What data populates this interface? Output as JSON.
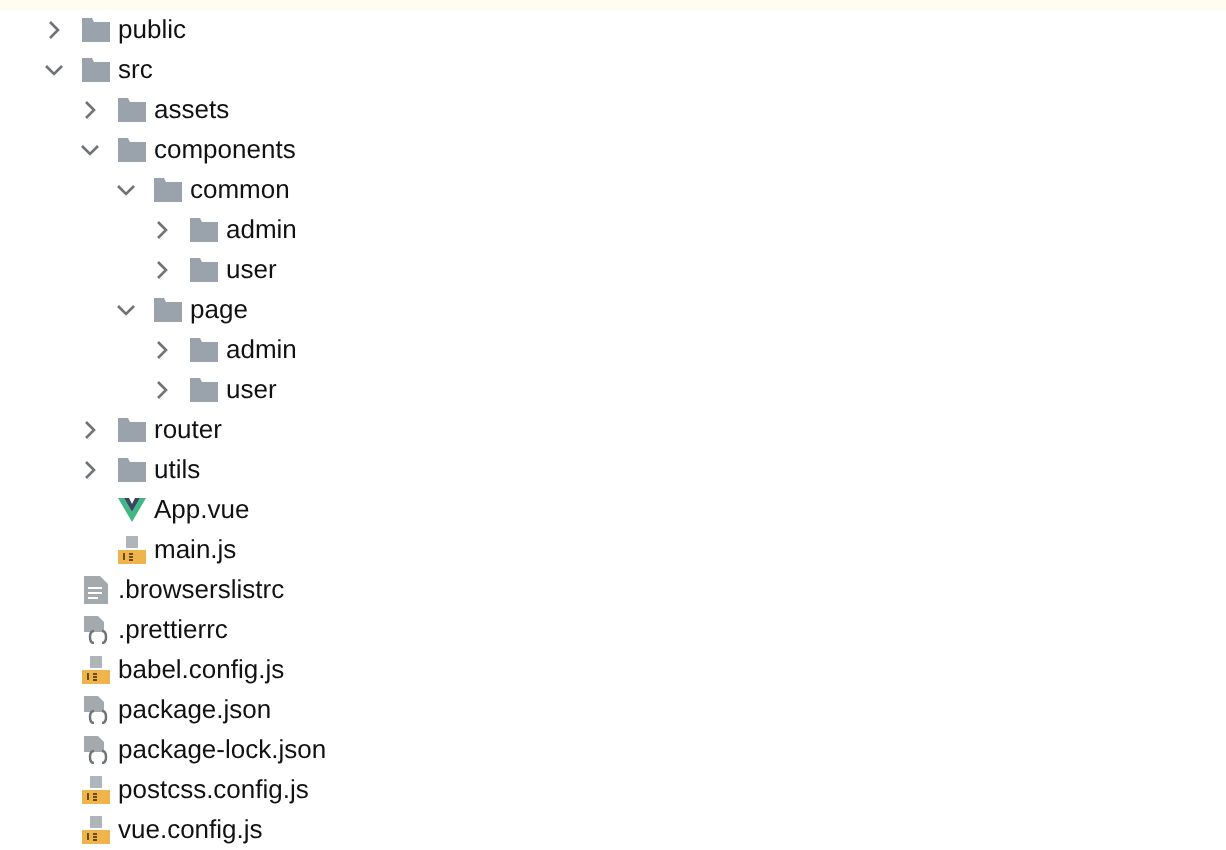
{
  "tree": [
    {
      "name": "public",
      "kind": "folder",
      "expanded": false
    },
    {
      "name": "src",
      "kind": "folder",
      "expanded": true,
      "children": [
        {
          "name": "assets",
          "kind": "folder",
          "expanded": false
        },
        {
          "name": "components",
          "kind": "folder",
          "expanded": true,
          "children": [
            {
              "name": "common",
              "kind": "folder",
              "expanded": true,
              "children": [
                {
                  "name": "admin",
                  "kind": "folder",
                  "expanded": false
                },
                {
                  "name": "user",
                  "kind": "folder",
                  "expanded": false
                }
              ]
            },
            {
              "name": "page",
              "kind": "folder",
              "expanded": true,
              "children": [
                {
                  "name": "admin",
                  "kind": "folder",
                  "expanded": false
                },
                {
                  "name": "user",
                  "kind": "folder",
                  "expanded": false
                }
              ]
            }
          ]
        },
        {
          "name": "router",
          "kind": "folder",
          "expanded": false
        },
        {
          "name": "utils",
          "kind": "folder",
          "expanded": false
        },
        {
          "name": "App.vue",
          "kind": "vue"
        },
        {
          "name": "main.js",
          "kind": "js"
        }
      ]
    },
    {
      "name": ".browserslistrc",
      "kind": "text"
    },
    {
      "name": ".prettierrc",
      "kind": "json"
    },
    {
      "name": "babel.config.js",
      "kind": "js"
    },
    {
      "name": "package.json",
      "kind": "json"
    },
    {
      "name": "package-lock.json",
      "kind": "json"
    },
    {
      "name": "postcss.config.js",
      "kind": "js"
    },
    {
      "name": "vue.config.js",
      "kind": "js"
    }
  ]
}
